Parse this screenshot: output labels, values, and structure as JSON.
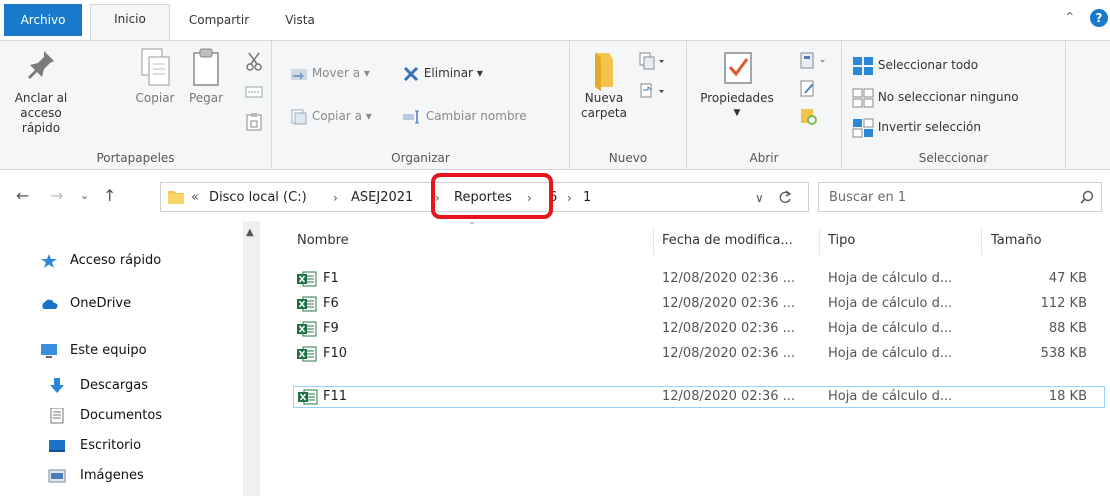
{
  "tabs": {
    "file": "Archivo",
    "home": "Inicio",
    "share": "Compartir",
    "view": "Vista"
  },
  "ribbon": {
    "clipboard": {
      "pin_label_1": "Anclar al",
      "pin_label_2": "acceso rápido",
      "copy": "Copiar",
      "paste": "Pegar",
      "group": "Portapapeles"
    },
    "organize": {
      "move_to": "Mover a",
      "copy_to": "Copiar a",
      "delete": "Eliminar",
      "rename": "Cambiar nombre",
      "group": "Organizar"
    },
    "new": {
      "new_folder_1": "Nueva",
      "new_folder_2": "carpeta",
      "group": "Nuevo"
    },
    "open": {
      "properties": "Propiedades",
      "group": "Abrir"
    },
    "select": {
      "select_all": "Seleccionar todo",
      "select_none": "No seleccionar ninguno",
      "invert": "Invertir selección",
      "group": "Seleccionar"
    }
  },
  "address": {
    "overflow": "«",
    "crumbs": [
      "Disco local (C:)",
      "ASEJ2021",
      "Reportes",
      "6",
      "1"
    ],
    "search_placeholder": "Buscar en 1"
  },
  "nav": {
    "items": [
      "Acceso rápido",
      "OneDrive",
      "Este equipo",
      "Descargas",
      "Documentos",
      "Escritorio",
      "Imágenes"
    ]
  },
  "columns": {
    "name": "Nombre",
    "date": "Fecha de modifica...",
    "type": "Tipo",
    "size": "Tamaño"
  },
  "files": [
    {
      "name": "F1",
      "date": "12/08/2020 02:36 ...",
      "type": "Hoja de cálculo d...",
      "size": "47 KB"
    },
    {
      "name": "F6",
      "date": "12/08/2020 02:36 ...",
      "type": "Hoja de cálculo d...",
      "size": "112 KB"
    },
    {
      "name": "F9",
      "date": "12/08/2020 02:36 ...",
      "type": "Hoja de cálculo d...",
      "size": "88 KB"
    },
    {
      "name": "F10",
      "date": "12/08/2020 02:36 ...",
      "type": "Hoja de cálculo d...",
      "size": "538 KB"
    },
    {
      "name": "F11",
      "date": "12/08/2020 02:36 ...",
      "type": "Hoja de cálculo d...",
      "size": "18 KB"
    }
  ],
  "colors": {
    "accent": "#1979ca",
    "highlight": "#e8141d",
    "selection_border": "#99d1ff"
  }
}
